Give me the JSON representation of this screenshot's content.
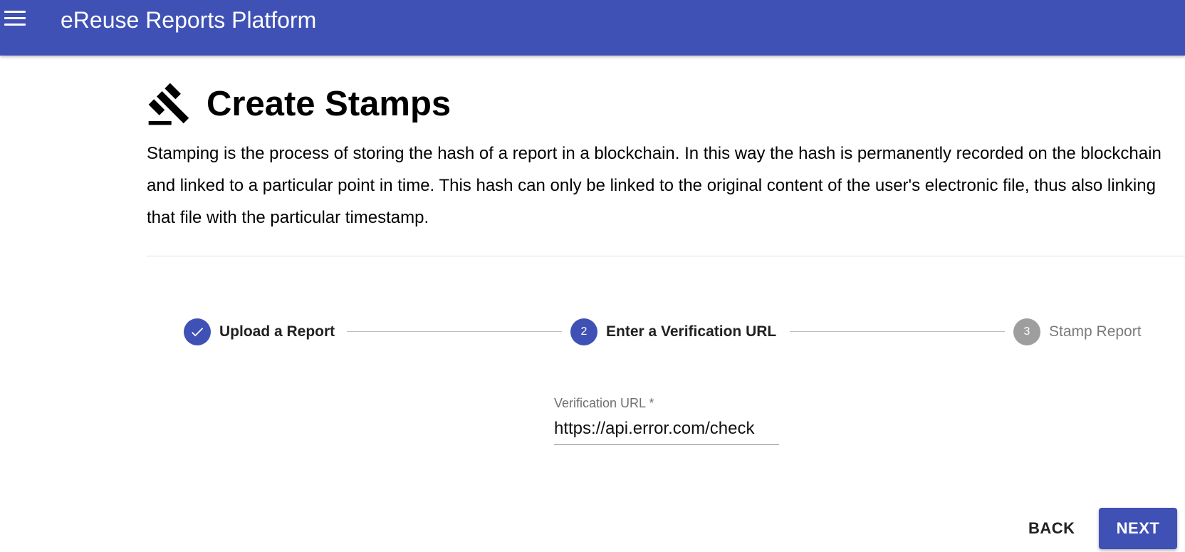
{
  "appbar": {
    "title": "eReuse Reports Platform",
    "color": "#3f51b5",
    "menu_icon": "menu-icon"
  },
  "page": {
    "icon": "gavel-icon",
    "title": "Create Stamps",
    "description": "Stamping is the process of storing the hash of a report in a blockchain. In this way the hash is permanently recorded on the blockchain and linked to a particular point in time. This hash can only be linked to the original content of the user's electronic file, thus also linking that file with the particular timestamp."
  },
  "stepper": {
    "steps": [
      {
        "label": "Upload a Report",
        "state": "completed",
        "icon": "check-icon"
      },
      {
        "number": "2",
        "label": "Enter a Verification URL",
        "state": "active"
      },
      {
        "number": "3",
        "label": "Stamp Report",
        "state": "inactive"
      }
    ]
  },
  "form": {
    "verification_label": "Verification URL *",
    "verification_value": "https://api.error.com/check"
  },
  "actions": {
    "back_label": "BACK",
    "next_label": "NEXT"
  },
  "colors": {
    "primary": "#3f51b5",
    "inactive_step": "#9e9e9e"
  }
}
